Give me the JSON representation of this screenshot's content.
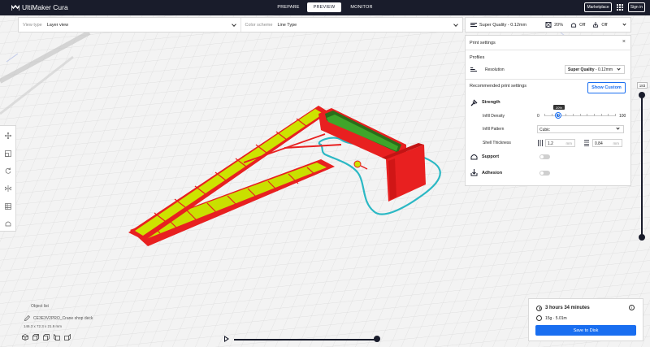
{
  "app": {
    "title": "UltiMaker Cura"
  },
  "stages": [
    {
      "label": "PREPARE",
      "active": false
    },
    {
      "label": "PREVIEW",
      "active": true
    },
    {
      "label": "MONITOR",
      "active": false
    }
  ],
  "topbar": {
    "marketplace": "Marketplace",
    "signin": "Sign in"
  },
  "header": {
    "view_type_label": "View type",
    "view_type_value": "Layer view",
    "color_scheme_label": "Color scheme",
    "color_scheme_value": "Line Type"
  },
  "quick": {
    "quality": "Super Quality - 0.12mm",
    "infill": "20%",
    "support": "Off",
    "adhesion": "Off"
  },
  "panel": {
    "title": "Print settings",
    "close": "×",
    "profiles": "Profiles",
    "resolution_label": "Resolution",
    "resolution_value": "Super Quality",
    "resolution_suffix": "- 0.12mm",
    "recommended": "Recommended print settings",
    "show_custom": "Show Custom",
    "strength": "Strength",
    "infill_density_label": "Infill Density",
    "infill_min": "0",
    "infill_max": "100",
    "infill_value_label": "20%",
    "infill_value": 20,
    "infill_pattern_label": "Infill Pattern",
    "infill_pattern_value": "Cubic",
    "shell_thickness_label": "Shell Thickness",
    "wall_value": "1.2",
    "wall_unit": "mm",
    "top_value": "0.84",
    "top_unit": "mm",
    "support": "Support",
    "support_on": false,
    "adhesion": "Adhesion",
    "adhesion_on": false
  },
  "layer": {
    "current": "183"
  },
  "objects": {
    "header": "Object list",
    "name": "CE3E3V2PRO_Crane shop deck",
    "dims": "146.3 x 72.3 x 21.9 mm"
  },
  "estimate": {
    "time": "3 hours 34 minutes",
    "material": "15g · 5.01m",
    "save": "Save to Disk"
  },
  "colors": {
    "topbar": "#191c2b",
    "accent": "#196ef0",
    "wall": "#ee1c1c",
    "infill": "#d6e600",
    "skirt": "#2bb8c4"
  }
}
